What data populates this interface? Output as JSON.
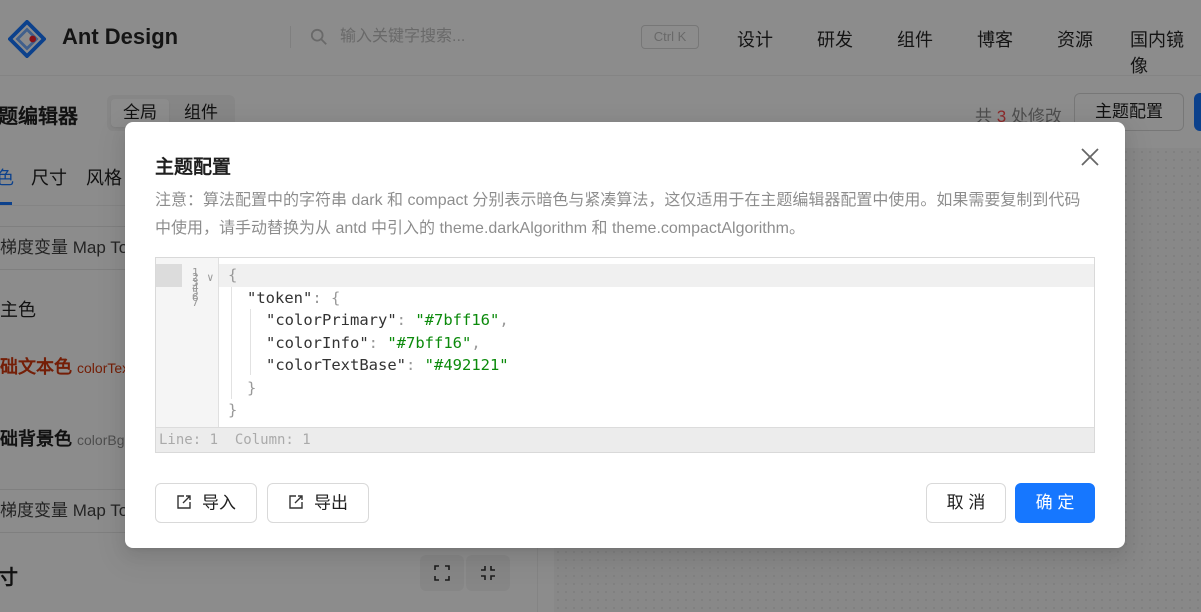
{
  "header": {
    "brand": "Ant Design",
    "search_placeholder": "输入关键字搜索...",
    "shortcut": "Ctrl K",
    "nav": [
      "设计",
      "研发",
      "组件",
      "博客",
      "资源",
      "国内镜像"
    ]
  },
  "toolbar": {
    "title": "题编辑器",
    "segments": [
      "全局",
      "组件"
    ],
    "changes_prefix": "共",
    "changes_count": "3",
    "changes_suffix": "处修改",
    "theme_config_button": "主题配置"
  },
  "sidebar": {
    "tabs": [
      "色",
      "尺寸",
      "风格"
    ],
    "map_token_1": "梯度变量 Map To",
    "base_color": "主色",
    "text_color_label": "础文本色",
    "text_color_token": "colorText",
    "bg_color_label": "础背景色",
    "bg_color_token": "colorBgB",
    "map_token_2": "梯度变量 Map To",
    "size_title": "寸"
  },
  "modal": {
    "title": "主题配置",
    "note": "注意：算法配置中的字符串 dark 和 compact 分别表示暗色与紧凑算法，这仅适用于在主题编辑器配置中使用。如果需要复制到代码中使用，请手动替换为从 antd 中引入的 theme.darkAlgorithm 和 theme.compactAlgorithm。",
    "code": {
      "token_key": "\"token\"",
      "entries": [
        {
          "key": "\"colorPrimary\"",
          "value": "\"#7bff16\"",
          "comma": ","
        },
        {
          "key": "\"colorInfo\"",
          "value": "\"#7bff16\"",
          "comma": ","
        },
        {
          "key": "\"colorTextBase\"",
          "value": "\"#492121\"",
          "comma": ""
        }
      ],
      "status": "Line: 1  Column: 1",
      "gutter_numbers": [
        "1",
        "2",
        "3",
        "4",
        "5",
        "6",
        "7"
      ]
    },
    "import_button": "导入",
    "export_button": "导出",
    "cancel_button": "取 消",
    "ok_button": "确 定"
  },
  "colors": {
    "primary": "#1677ff",
    "string": "#0b8a0b",
    "accent_orange": "#d4380d"
  }
}
